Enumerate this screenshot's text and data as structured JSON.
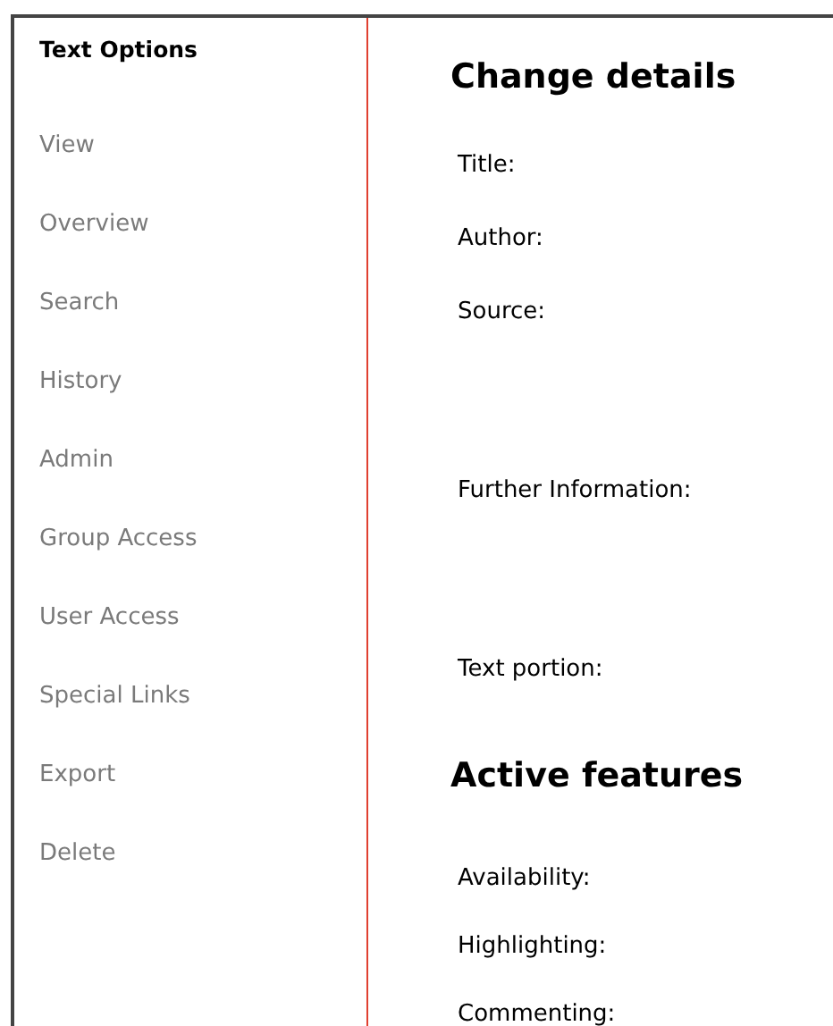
{
  "sidebar": {
    "title": "Text Options",
    "items": [
      {
        "label": "View"
      },
      {
        "label": "Overview"
      },
      {
        "label": "Search"
      },
      {
        "label": "History"
      },
      {
        "label": "Admin"
      },
      {
        "label": "Group Access"
      },
      {
        "label": "User Access"
      },
      {
        "label": "Special Links"
      },
      {
        "label": "Export"
      },
      {
        "label": "Delete"
      }
    ]
  },
  "sections": [
    {
      "heading": "Change details",
      "fields": [
        {
          "label": "Title:"
        },
        {
          "label": "Author:"
        },
        {
          "label": "Source:"
        },
        {
          "label": "Further Information:"
        },
        {
          "label": "Text portion:"
        }
      ]
    },
    {
      "heading": "Active features",
      "fields": [
        {
          "label": "Availability:"
        },
        {
          "label": "Highlighting:"
        },
        {
          "label": "Commenting:"
        }
      ]
    }
  ]
}
